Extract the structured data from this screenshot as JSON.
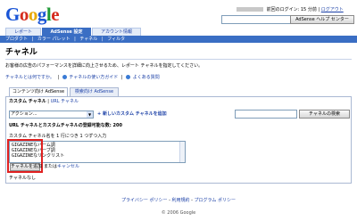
{
  "logo": {
    "text": "Google"
  },
  "top": {
    "last_login": "前回のログイン: 15 分前",
    "logout": "ログアウト",
    "help_button": "AdSense ヘルプ センター"
  },
  "tabs": [
    "レポート",
    "AdSense 設定",
    "アカウント情報"
  ],
  "subnav": [
    "プロダクト",
    "|",
    "カラー パレット",
    "|",
    "チャネル",
    "|",
    "フィルタ"
  ],
  "page": {
    "title": "チャネル",
    "description": "お客様の広告のパフォーマンスを詳細に向上させるため、レポート チャネルを指定してください。",
    "links": [
      "チャネルとは何ですか。",
      "チャネルの使い方ガイド",
      "よくある質問"
    ]
  },
  "content_tabs": [
    "コンテンツ向け AdSense",
    "検索向け AdSense"
  ],
  "channel_type": {
    "current": "カスタム チャネル",
    "other": "URL チャネル"
  },
  "actions": {
    "select_value": "アクション...",
    "new_channel": "新しいカスタム チャネルを追加",
    "search_value": "",
    "search_button": "チャネルの検索"
  },
  "note": "URL チャネルとカスタムチャネルの登録可能な数: 200",
  "input": {
    "label": "カスタム チャネル名を 1 行につき 1 つずつ入力",
    "lines": [
      "GIGAZINEなバーム調",
      "GIGAZINEなバーブ調",
      "GIGAZINEなリンクリスト"
    ],
    "add_button": "チャネルを追加",
    "or_text": "または",
    "cancel": "キャンセル"
  },
  "empty_state": "チャネルなし",
  "footer": {
    "links": [
      "プライバシー ポリシー",
      "利用規約",
      "プログラム ポリシー"
    ],
    "copyright": "© 2006 Google"
  },
  "colors": {
    "accent": "#3a6ec4",
    "link": "#1a3fa6",
    "highlight": "#e02020"
  }
}
